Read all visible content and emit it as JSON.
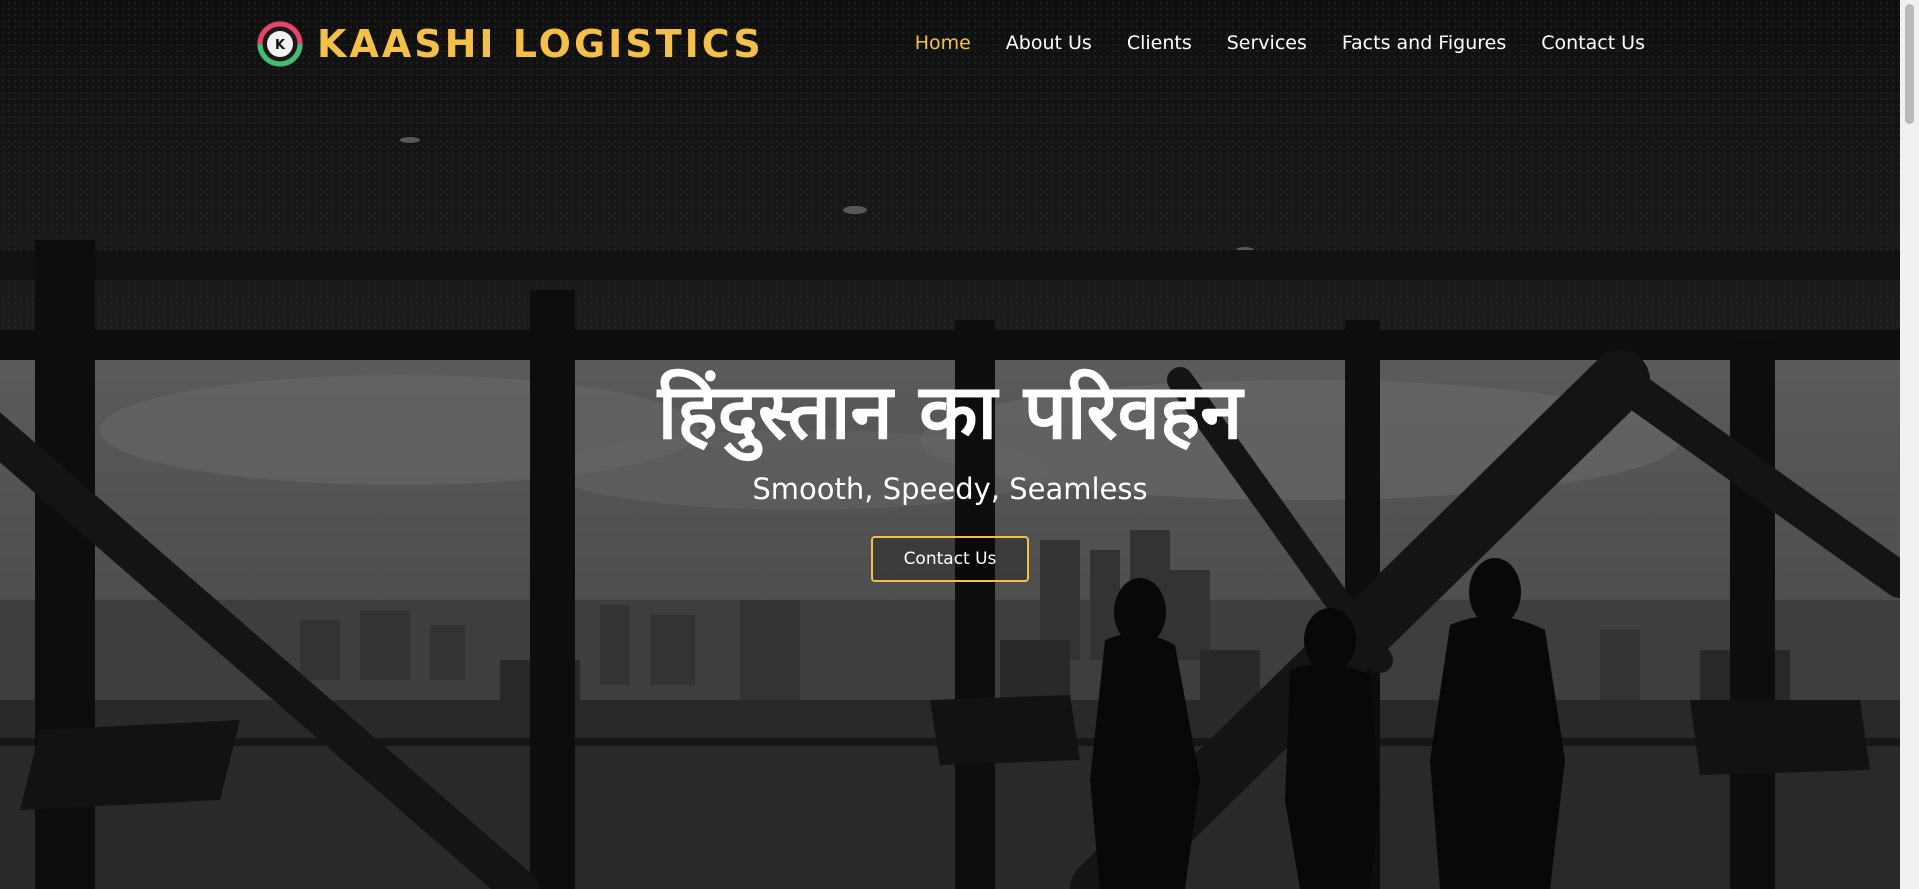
{
  "header": {
    "brand_name": "KAASHI LOGISTICS",
    "logo_icon": "kaashi-logo-icon",
    "nav": [
      {
        "label": "Home",
        "active": true
      },
      {
        "label": "About Us",
        "active": false
      },
      {
        "label": "Clients",
        "active": false
      },
      {
        "label": "Services",
        "active": false
      },
      {
        "label": "Facts and Figures",
        "active": false
      },
      {
        "label": "Contact Us",
        "active": false
      }
    ]
  },
  "hero": {
    "title": "हिंदुस्तान का परिवहन",
    "subtitle": "Smooth, Speedy, Seamless",
    "cta_label": "Contact Us"
  },
  "colors": {
    "accent": "#f5c04a",
    "text": "#ffffff",
    "overlay": "#000000"
  }
}
